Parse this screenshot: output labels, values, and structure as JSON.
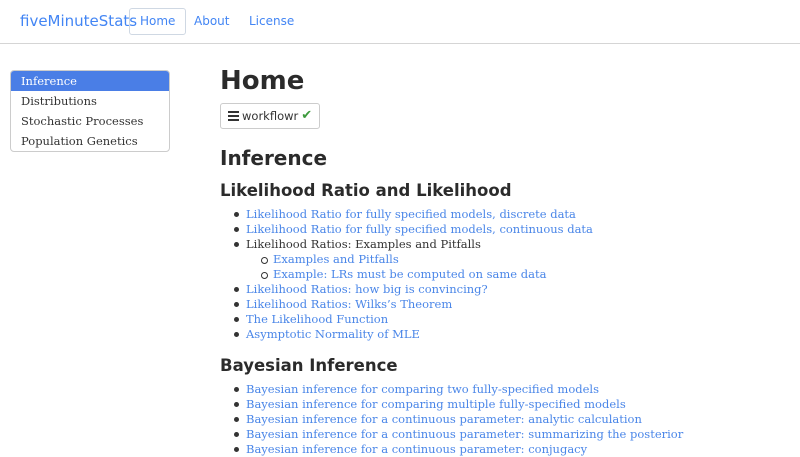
{
  "navbar": {
    "brand": "fiveMinuteStats",
    "items": [
      {
        "label": "Home"
      },
      {
        "label": "About"
      },
      {
        "label": "License"
      }
    ]
  },
  "toc": {
    "items": [
      {
        "label": "Inference",
        "active": true
      },
      {
        "label": "Distributions"
      },
      {
        "label": "Stochastic Processes"
      },
      {
        "label": "Population Genetics"
      }
    ]
  },
  "main": {
    "title": "Home",
    "workflowr_label": "workflowr",
    "section_inference": "Inference",
    "likelihood": {
      "heading": "Likelihood Ratio and Likelihood",
      "items": [
        "Likelihood Ratio for fully specified models, discrete data",
        "Likelihood Ratio for fully specified models, continuous data",
        "Likelihood Ratios: Examples and Pitfalls",
        "Examples and Pitfalls",
        "Example: LRs must be computed on same data",
        "Likelihood Ratios: how big is convincing?",
        "Likelihood Ratios: Wilks’s Theorem",
        "The Likelihood Function",
        "Asymptotic Normality of MLE"
      ]
    },
    "bayesian": {
      "heading": "Bayesian Inference",
      "items": [
        "Bayesian inference for comparing two fully-specified models",
        "Bayesian inference for comparing multiple fully-specified models",
        "Bayesian inference for a continuous parameter: analytic calculation",
        "Bayesian inference for a continuous parameter: summarizing the posterior",
        "Bayesian inference for a continuous parameter: conjugacy"
      ]
    }
  },
  "colors": {
    "link": "#4a86e8",
    "toc_active": "#4a7ee6",
    "check": "#3c9a3c"
  }
}
